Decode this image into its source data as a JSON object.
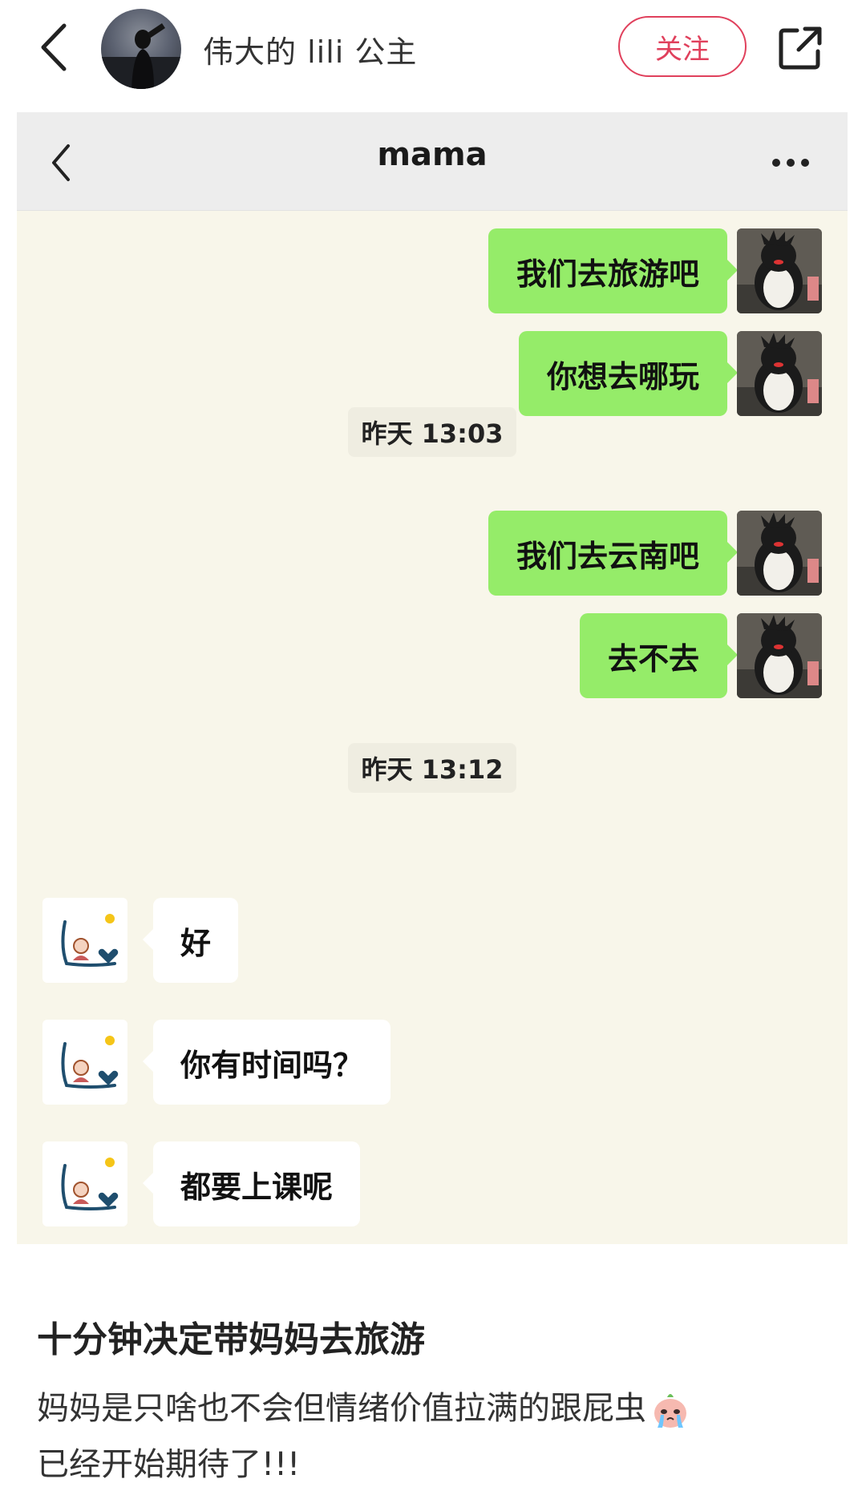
{
  "header": {
    "username": "伟大的 lili 公主",
    "follow_label": "关注",
    "icons": [
      "back-arrow-icon",
      "share-icon"
    ]
  },
  "chat": {
    "title": "mama",
    "messages": [
      {
        "side": "right",
        "text": "我们去旅游吧"
      },
      {
        "side": "right",
        "text": "你想去哪玩"
      },
      {
        "type": "time",
        "text": "昨天 13:03"
      },
      {
        "side": "right",
        "text": "我们去云南吧"
      },
      {
        "side": "right",
        "text": "去不去"
      },
      {
        "type": "time",
        "text": "昨天 13:12"
      },
      {
        "side": "left",
        "text": "好"
      },
      {
        "side": "left",
        "text": "你有时间吗？"
      },
      {
        "side": "left",
        "text": "都要上课呢"
      }
    ]
  },
  "post": {
    "title": "十分钟决定带妈妈去旅游",
    "line1": "妈妈是只啥也不会但情绪价值拉满的跟屁虫",
    "line2": "已经开始期待了!!!"
  },
  "colors": {
    "accent": "#e0405c",
    "bubble_green": "#95ec69",
    "chat_bg": "#f8f6ea"
  }
}
